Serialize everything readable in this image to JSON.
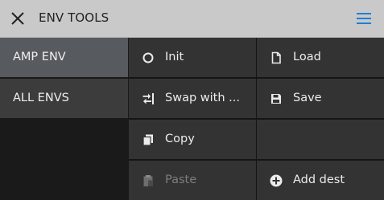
{
  "header": {
    "title": "ENV TOOLS",
    "close_icon": "close-icon",
    "menu_icon": "hamburger-menu-icon",
    "accent_color": "#1e7fd6"
  },
  "sidebar": {
    "items": [
      {
        "label": "AMP ENV",
        "selected": true
      },
      {
        "label": "ALL ENVS",
        "selected": false
      }
    ]
  },
  "actions": {
    "init": {
      "label": "Init",
      "icon": "circle-icon"
    },
    "load": {
      "label": "Load",
      "icon": "file-icon"
    },
    "swap": {
      "label": "Swap with ...",
      "icon": "swap-icon"
    },
    "save": {
      "label": "Save",
      "icon": "save-icon"
    },
    "copy": {
      "label": "Copy",
      "icon": "copy-icon"
    },
    "paste": {
      "label": "Paste",
      "icon": "paste-icon",
      "disabled": true
    },
    "add_dest": {
      "label": "Add dest",
      "icon": "add-circle-icon"
    }
  },
  "colors": {
    "header_bg": "#c9c9c9",
    "selected_bg": "#575a5f",
    "cell_bg": "#333333",
    "disabled_text": "#7d7d7d"
  }
}
